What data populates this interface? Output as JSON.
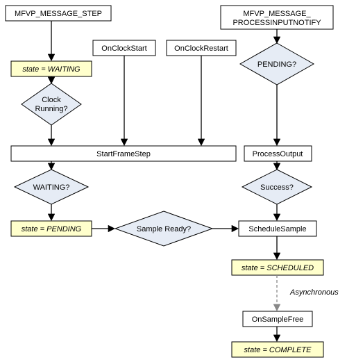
{
  "chart_data": {
    "type": "flowchart",
    "nodes": {
      "msg_step": {
        "kind": "process",
        "label": "MFVP_MESSAGE_STEP"
      },
      "msg_process": {
        "kind": "process",
        "label": "MFVP_MESSAGE_"
      },
      "msg_process2": {
        "kind": "process",
        "label": "PROCESSINPUTNOTIFY"
      },
      "onclockstart": {
        "kind": "process",
        "label": "OnClockStart"
      },
      "onclockrestart": {
        "kind": "process",
        "label": "OnClockRestart"
      },
      "state_waiting": {
        "kind": "state",
        "label": "state = WAITING"
      },
      "clockrunning": {
        "kind": "decision",
        "label": "Clock",
        "label2": "Running?"
      },
      "pendingq": {
        "kind": "decision",
        "label": "PENDING?"
      },
      "startframestep": {
        "kind": "process",
        "label": "StartFrameStep"
      },
      "processoutput": {
        "kind": "process",
        "label": "ProcessOutput"
      },
      "waitingq": {
        "kind": "decision",
        "label": "WAITING?"
      },
      "successq": {
        "kind": "decision",
        "label": "Success?"
      },
      "state_pending": {
        "kind": "state",
        "label": "state = PENDING"
      },
      "sampleready": {
        "kind": "decision",
        "label": "Sample Ready?"
      },
      "schedulesample": {
        "kind": "process",
        "label": "ScheduleSample"
      },
      "state_scheduled": {
        "kind": "state",
        "label": "state = SCHEDULED"
      },
      "async_label": {
        "kind": "label",
        "label": "Asynchronous"
      },
      "onsamplefree": {
        "kind": "process",
        "label": "OnSampleFree"
      },
      "state_complete": {
        "kind": "state",
        "label": "state = COMPLETE"
      }
    },
    "edges": [
      {
        "from": "msg_step",
        "to": "state_waiting"
      },
      {
        "from": "state_waiting",
        "to": "clockrunning"
      },
      {
        "from": "clockrunning",
        "to": "startframestep"
      },
      {
        "from": "onclockstart",
        "to": "startframestep"
      },
      {
        "from": "onclockrestart",
        "to": "startframestep"
      },
      {
        "from": "startframestep",
        "to": "waitingq"
      },
      {
        "from": "waitingq",
        "to": "state_pending"
      },
      {
        "from": "state_pending",
        "to": "sampleready"
      },
      {
        "from": "sampleready",
        "to": "schedulesample"
      },
      {
        "from": "msg_process",
        "to": "pendingq"
      },
      {
        "from": "pendingq",
        "to": "processoutput"
      },
      {
        "from": "processoutput",
        "to": "successq"
      },
      {
        "from": "successq",
        "to": "schedulesample"
      },
      {
        "from": "schedulesample",
        "to": "state_scheduled"
      },
      {
        "from": "state_scheduled",
        "to": "onsamplefree",
        "style": "dash"
      },
      {
        "from": "onsamplefree",
        "to": "state_complete"
      }
    ]
  }
}
